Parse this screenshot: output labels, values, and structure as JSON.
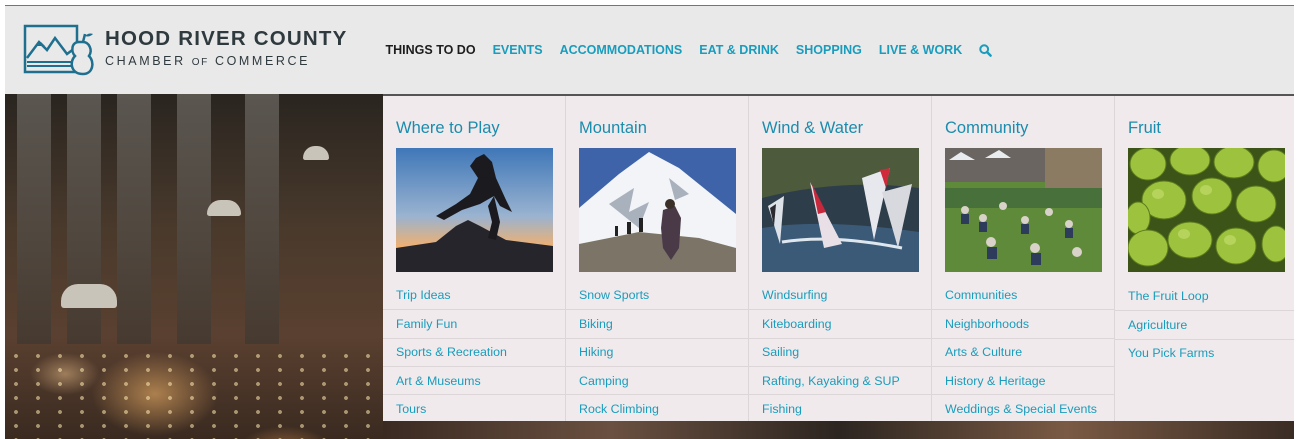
{
  "logo": {
    "line1": "HOOD RIVER COUNTY",
    "line2_pre": "CHAMBER",
    "line2_of": "OF",
    "line2_post": "COMMERCE",
    "icon": "mountain-pear-logo-icon"
  },
  "nav": {
    "items": [
      {
        "label": "THINGS TO DO",
        "active": true
      },
      {
        "label": "EVENTS"
      },
      {
        "label": "ACCOMMODATIONS"
      },
      {
        "label": "EAT & DRINK"
      },
      {
        "label": "SHOPPING"
      },
      {
        "label": "LIVE & WORK"
      }
    ],
    "search_icon": "search-icon"
  },
  "colors": {
    "accent": "#1a9cbc",
    "header_bg": "#e9e9e9",
    "menu_bg": "#f0eaec",
    "text_dark": "#2f3a3f"
  },
  "menu": {
    "columns": [
      {
        "title": "Where to Play",
        "image": "jumping-person-silhouette-photo",
        "links": [
          "Trip Ideas",
          "Family Fun",
          "Sports & Recreation",
          "Art & Museums",
          "Tours"
        ]
      },
      {
        "title": "Mountain",
        "image": "snowy-mountain-hikers-photo",
        "links": [
          "Snow Sports",
          "Biking",
          "Hiking",
          "Camping",
          "Rock Climbing"
        ]
      },
      {
        "title": "Wind & Water",
        "image": "windsurfers-photo",
        "links": [
          "Windsurfing",
          "Kiteboarding",
          "Sailing",
          "Rafting, Kayaking & SUP",
          "Fishing"
        ]
      },
      {
        "title": "Community",
        "image": "outdoor-festival-crowd-photo",
        "links": [
          "Communities",
          "Neighborhoods",
          "Arts & Culture",
          "History & Heritage",
          "Weddings & Special Events"
        ]
      },
      {
        "title": "Fruit",
        "image": "green-pears-photo",
        "links": [
          "The Fruit Loop",
          "Agriculture",
          "You Pick Farms"
        ]
      }
    ]
  }
}
